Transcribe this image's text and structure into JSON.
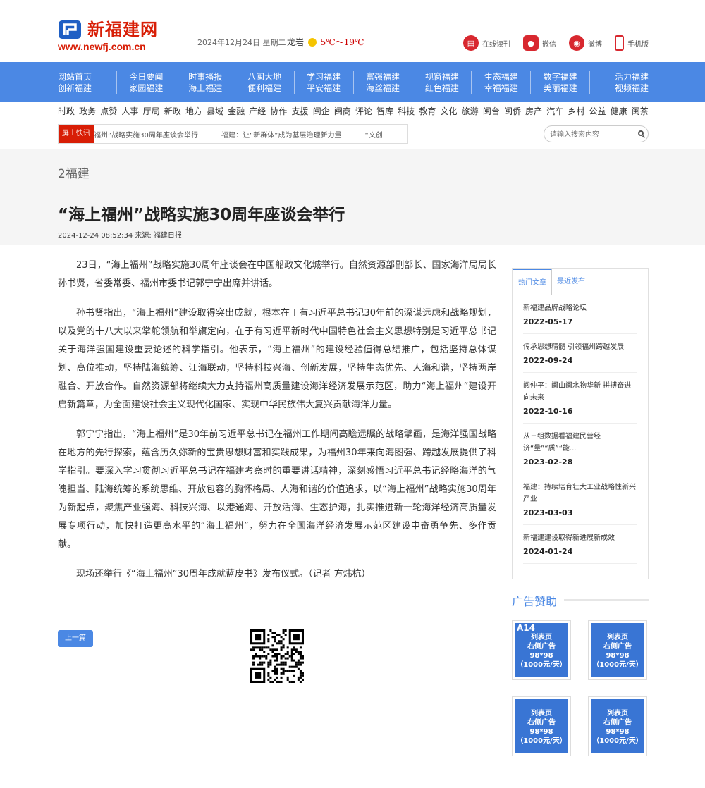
{
  "header": {
    "logo_name": "新福建网",
    "logo_url": "www.newfj.com.cn",
    "date": "2024年12月24日 星期二",
    "city": "龙岩",
    "temp": "5℃～19℃",
    "tools": [
      {
        "label": "在线读刊",
        "icon": "book-icon"
      },
      {
        "label": "微信",
        "icon": "wechat-icon"
      },
      {
        "label": "微博",
        "icon": "weibo-icon"
      },
      {
        "label": "手机版",
        "icon": "phone-icon"
      }
    ]
  },
  "nav": [
    {
      "l1": "网站首页",
      "l2": "创新福建"
    },
    {
      "l1": "今日要闻",
      "l2": "家园福建"
    },
    {
      "l1": "时事播报",
      "l2": "海上福建"
    },
    {
      "l1": "八闽大地",
      "l2": "便利福建"
    },
    {
      "l1": "学习福建",
      "l2": "平安福建"
    },
    {
      "l1": "富强福建",
      "l2": "海丝福建"
    },
    {
      "l1": "视窗福建",
      "l2": "红色福建"
    },
    {
      "l1": "生态福建",
      "l2": "幸福福建"
    },
    {
      "l1": "数字福建",
      "l2": "美丽福建"
    },
    {
      "l1": "活力福建",
      "l2": "视频福建"
    }
  ],
  "channels": [
    "时政",
    "政务",
    "点赞",
    "人事",
    "厅局",
    "新政",
    "地方",
    "县域",
    "金融",
    "产经",
    "协作",
    "支援",
    "闽企",
    "闽商",
    "评论",
    "智库",
    "科技",
    "教育",
    "文化",
    "旅游",
    "闽台",
    "闽侨",
    "房产",
    "汽车",
    "乡村",
    "公益",
    "健康",
    "闽茶"
  ],
  "ticker": {
    "tag": "屏山快讯",
    "items": [
      "福州”战略实施30周年座谈会举行",
      "福建：让“新群体”成为基层治理新力量",
      "“文创"
    ]
  },
  "search": {
    "placeholder": "请输入搜索内容"
  },
  "article": {
    "crumb": "2福建",
    "title": "“海上福州”战略实施30周年座谈会举行",
    "meta": "2024-12-24 08:52:34   来源:   福建日报",
    "paragraphs": [
      "23日，“海上福州”战略实施30周年座谈会在中国船政文化城举行。自然资源部副部长、国家海洋局局长孙书贤，省委常委、福州市委书记郭宁宁出席并讲话。",
      "孙书贤指出，“海上福州”建设取得突出成就，根本在于有习近平总书记30年前的深谋远虑和战略规划，以及党的十八大以来掌舵领航和举旗定向，在于有习近平新时代中国特色社会主义思想特别是习近平总书记关于海洋强国建设重要论述的科学指引。他表示，“海上福州”的建设经验值得总结推广，包括坚持总体谋划、高位推动，坚持陆海统筹、江海联动，坚持科技兴海、创新发展，坚持生态优先、人海和谐，坚持两岸融合、开放合作。自然资源部将继续大力支持福州高质量建设海洋经济发展示范区，助力“海上福州”建设开启新篇章，为全面建设社会主义现代化国家、实现中华民族伟大复兴贡献海洋力量。",
      "郭宁宁指出，“海上福州”是30年前习近平总书记在福州工作期间高瞻远瞩的战略擘画，是海洋强国战略在地方的先行探索，蕴含历久弥新的宝贵思想财富和实践成果，为福州30年来向海图强、跨越发展提供了科学指引。要深入学习贯彻习近平总书记在福建考察时的重要讲话精神，深刻感悟习近平总书记经略海洋的气魄担当、陆海统筹的系统思维、开放包容的胸怀格局、人海和谐的价值追求，以“海上福州”战略实施30周年为新起点，聚焦产业强海、科技兴海、以港通海、开放活海、生态护海，扎实推进新一轮海洋经济高质量发展专项行动，加快打造更高水平的“海上福州”，努力在全国海洋经济发展示范区建设中奋勇争先、多作贡献。",
      "现场还举行《“海上福州”30周年成就蓝皮书》发布仪式。（记者 方炜杭）"
    ],
    "prev_label": "上一篇"
  },
  "sidebar": {
    "tabs": [
      "热门文章",
      "最近发布"
    ],
    "items": [
      {
        "title": "新福建品牌战略论坛",
        "date": "2022-05-17"
      },
      {
        "title": "传承思想精髓 引领福州跨越发展",
        "date": "2022-09-24"
      },
      {
        "title": "阅仲平：闽山闽水物华新 拼搏奋进向未来",
        "date": "2022-10-16"
      },
      {
        "title": "从三组数据看福建民营经济“量”“质”“能...",
        "date": "2023-02-28"
      },
      {
        "title": "福建：持续培育壮大工业战略性新兴产业",
        "date": "2023-03-03"
      },
      {
        "title": "新福建建设取得新进展新成效",
        "date": "2024-01-24"
      }
    ],
    "ad_title": "广告赞助",
    "ads": [
      {
        "tag": "A14",
        "l1": "列表页",
        "l2": "右侧广告",
        "l3": "98*98",
        "l4": "（1000元/天）"
      },
      {
        "tag": "",
        "l1": "列表页",
        "l2": "右侧广告",
        "l3": "98*98",
        "l4": "（1000元/天）"
      },
      {
        "tag": "",
        "l1": "列表页",
        "l2": "右侧广告",
        "l3": "98*98",
        "l4": "（1000元/天）"
      },
      {
        "tag": "",
        "l1": "列表页",
        "l2": "右侧广告",
        "l3": "98*98",
        "l4": "（1000元/天）"
      }
    ]
  },
  "colors": {
    "brand_red": "#d81e06",
    "nav_blue": "#4b88e4"
  }
}
